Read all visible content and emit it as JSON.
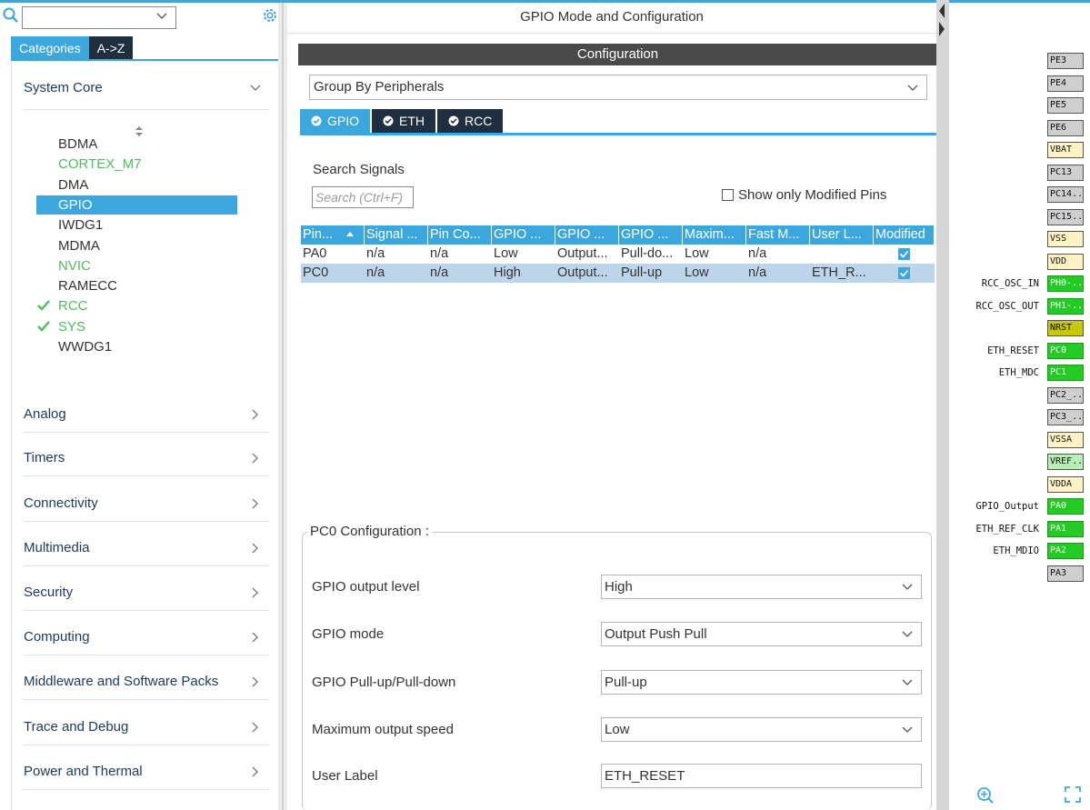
{
  "left": {
    "tabs": [
      "Categories",
      "A->Z"
    ],
    "sections": [
      {
        "label": "System Core"
      },
      {
        "label": "Analog"
      },
      {
        "label": "Timers"
      },
      {
        "label": "Connectivity"
      },
      {
        "label": "Multimedia"
      },
      {
        "label": "Security"
      },
      {
        "label": "Computing"
      },
      {
        "label": "Middleware and Software Packs"
      },
      {
        "label": "Trace and Debug"
      },
      {
        "label": "Power and Thermal"
      }
    ],
    "system_core_items": [
      {
        "label": "BDMA",
        "state": "normal"
      },
      {
        "label": "CORTEX_M7",
        "state": "green"
      },
      {
        "label": "DMA",
        "state": "normal"
      },
      {
        "label": "GPIO",
        "state": "selected"
      },
      {
        "label": "IWDG1",
        "state": "normal"
      },
      {
        "label": "MDMA",
        "state": "normal"
      },
      {
        "label": "NVIC",
        "state": "green"
      },
      {
        "label": "RAMECC",
        "state": "normal"
      },
      {
        "label": "RCC",
        "state": "checked"
      },
      {
        "label": "SYS",
        "state": "checked"
      },
      {
        "label": "WWDG1",
        "state": "normal"
      }
    ]
  },
  "center": {
    "title": "GPIO Mode and Configuration",
    "config_bar": "Configuration",
    "group_select": "Group By Peripherals",
    "tabs": [
      "GPIO",
      "ETH",
      "RCC"
    ],
    "search_label": "Search Signals",
    "search_placeholder": "Search (Ctrl+F)",
    "modified_pins": "Show only Modified Pins",
    "table": {
      "headers": [
        "Pin...",
        "Signal ...",
        "Pin Co...",
        "GPIO ...",
        "GPIO ...",
        "GPIO ...",
        "Maxim...",
        "Fast M...",
        "User L...",
        "Modified"
      ],
      "rows": [
        [
          "PA0",
          "n/a",
          "n/a",
          "Low",
          "Output...",
          "Pull-do...",
          "Low",
          "n/a",
          "",
          "checked"
        ],
        [
          "PC0",
          "n/a",
          "n/a",
          "High",
          "Output...",
          "Pull-up",
          "Low",
          "n/a",
          "ETH_R...",
          "checked"
        ]
      ]
    },
    "pc0": {
      "title": "PC0 Configuration :",
      "props": [
        {
          "label": "GPIO output level",
          "value": "High"
        },
        {
          "label": "GPIO mode",
          "value": "Output Push Pull"
        },
        {
          "label": "GPIO Pull-up/Pull-down",
          "value": "Pull-up"
        },
        {
          "label": "Maximum output speed",
          "value": "Low"
        },
        {
          "label": "User Label",
          "value": "ETH_RESET"
        }
      ]
    }
  },
  "pins": [
    {
      "pin": "PE3",
      "color": "gray",
      "label": ""
    },
    {
      "pin": "PE4",
      "color": "gray",
      "label": ""
    },
    {
      "pin": "PE5",
      "color": "gray",
      "label": ""
    },
    {
      "pin": "PE6",
      "color": "gray",
      "label": ""
    },
    {
      "pin": "VBAT",
      "color": "yellow",
      "label": ""
    },
    {
      "pin": "PC13",
      "color": "gray",
      "label": ""
    },
    {
      "pin": "PC14..",
      "color": "gray",
      "label": ""
    },
    {
      "pin": "PC15..",
      "color": "gray",
      "label": ""
    },
    {
      "pin": "VSS",
      "color": "yellow",
      "label": ""
    },
    {
      "pin": "VDD",
      "color": "yellow",
      "label": ""
    },
    {
      "pin": "PH0-..",
      "color": "green",
      "label": "RCC_OSC_IN"
    },
    {
      "pin": "PH1-..",
      "color": "green",
      "label": "RCC_OSC_OUT"
    },
    {
      "pin": "NRST",
      "color": "olive",
      "label": ""
    },
    {
      "pin": "PC0",
      "color": "green",
      "label": "ETH_RESET"
    },
    {
      "pin": "PC1",
      "color": "green",
      "label": "ETH_MDC"
    },
    {
      "pin": "PC2_..",
      "color": "gray",
      "label": ""
    },
    {
      "pin": "PC3_..",
      "color": "gray",
      "label": ""
    },
    {
      "pin": "VSSA",
      "color": "yellow",
      "label": ""
    },
    {
      "pin": "VREF..",
      "color": "light",
      "label": ""
    },
    {
      "pin": "VDDA",
      "color": "yellow",
      "label": ""
    },
    {
      "pin": "PA0",
      "color": "green",
      "label": "GPIO_Output"
    },
    {
      "pin": "PA1",
      "color": "green",
      "label": "ETH_REF_CLK"
    },
    {
      "pin": "PA2",
      "color": "green",
      "label": "ETH_MDIO"
    },
    {
      "pin": "PA3",
      "color": "gray",
      "label": ""
    }
  ]
}
